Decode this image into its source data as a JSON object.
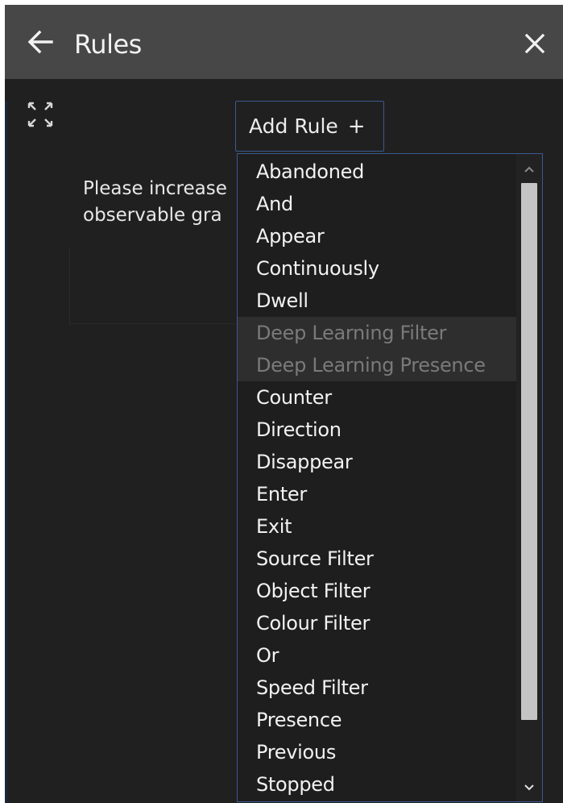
{
  "header": {
    "title": "Rules",
    "back_icon": "arrow-left-icon",
    "close_icon": "close-icon"
  },
  "toolbar": {
    "expand_icon": "expand-icon",
    "add_rule_label": "Add Rule",
    "add_rule_plus": "+"
  },
  "message": {
    "line1": "Please increase",
    "line2": "observable gra"
  },
  "dropdown": {
    "options": [
      {
        "label": "Abandoned",
        "disabled": false
      },
      {
        "label": "And",
        "disabled": false
      },
      {
        "label": "Appear",
        "disabled": false
      },
      {
        "label": "Continuously",
        "disabled": false
      },
      {
        "label": "Dwell",
        "disabled": false
      },
      {
        "label": "Deep Learning Filter",
        "disabled": true
      },
      {
        "label": "Deep Learning Presence",
        "disabled": true
      },
      {
        "label": "Counter",
        "disabled": false
      },
      {
        "label": "Direction",
        "disabled": false
      },
      {
        "label": "Disappear",
        "disabled": false
      },
      {
        "label": "Enter",
        "disabled": false
      },
      {
        "label": "Exit",
        "disabled": false
      },
      {
        "label": "Source Filter",
        "disabled": false
      },
      {
        "label": "Object Filter",
        "disabled": false
      },
      {
        "label": "Colour Filter",
        "disabled": false
      },
      {
        "label": "Or",
        "disabled": false
      },
      {
        "label": "Speed Filter",
        "disabled": false
      },
      {
        "label": "Presence",
        "disabled": false
      },
      {
        "label": "Previous",
        "disabled": false
      },
      {
        "label": "Stopped",
        "disabled": false
      }
    ]
  },
  "colors": {
    "panel_bg": "#202020",
    "header_bg": "#474747",
    "accent_border": "#3b5b90",
    "disabled_text": "#7a7a7a"
  }
}
